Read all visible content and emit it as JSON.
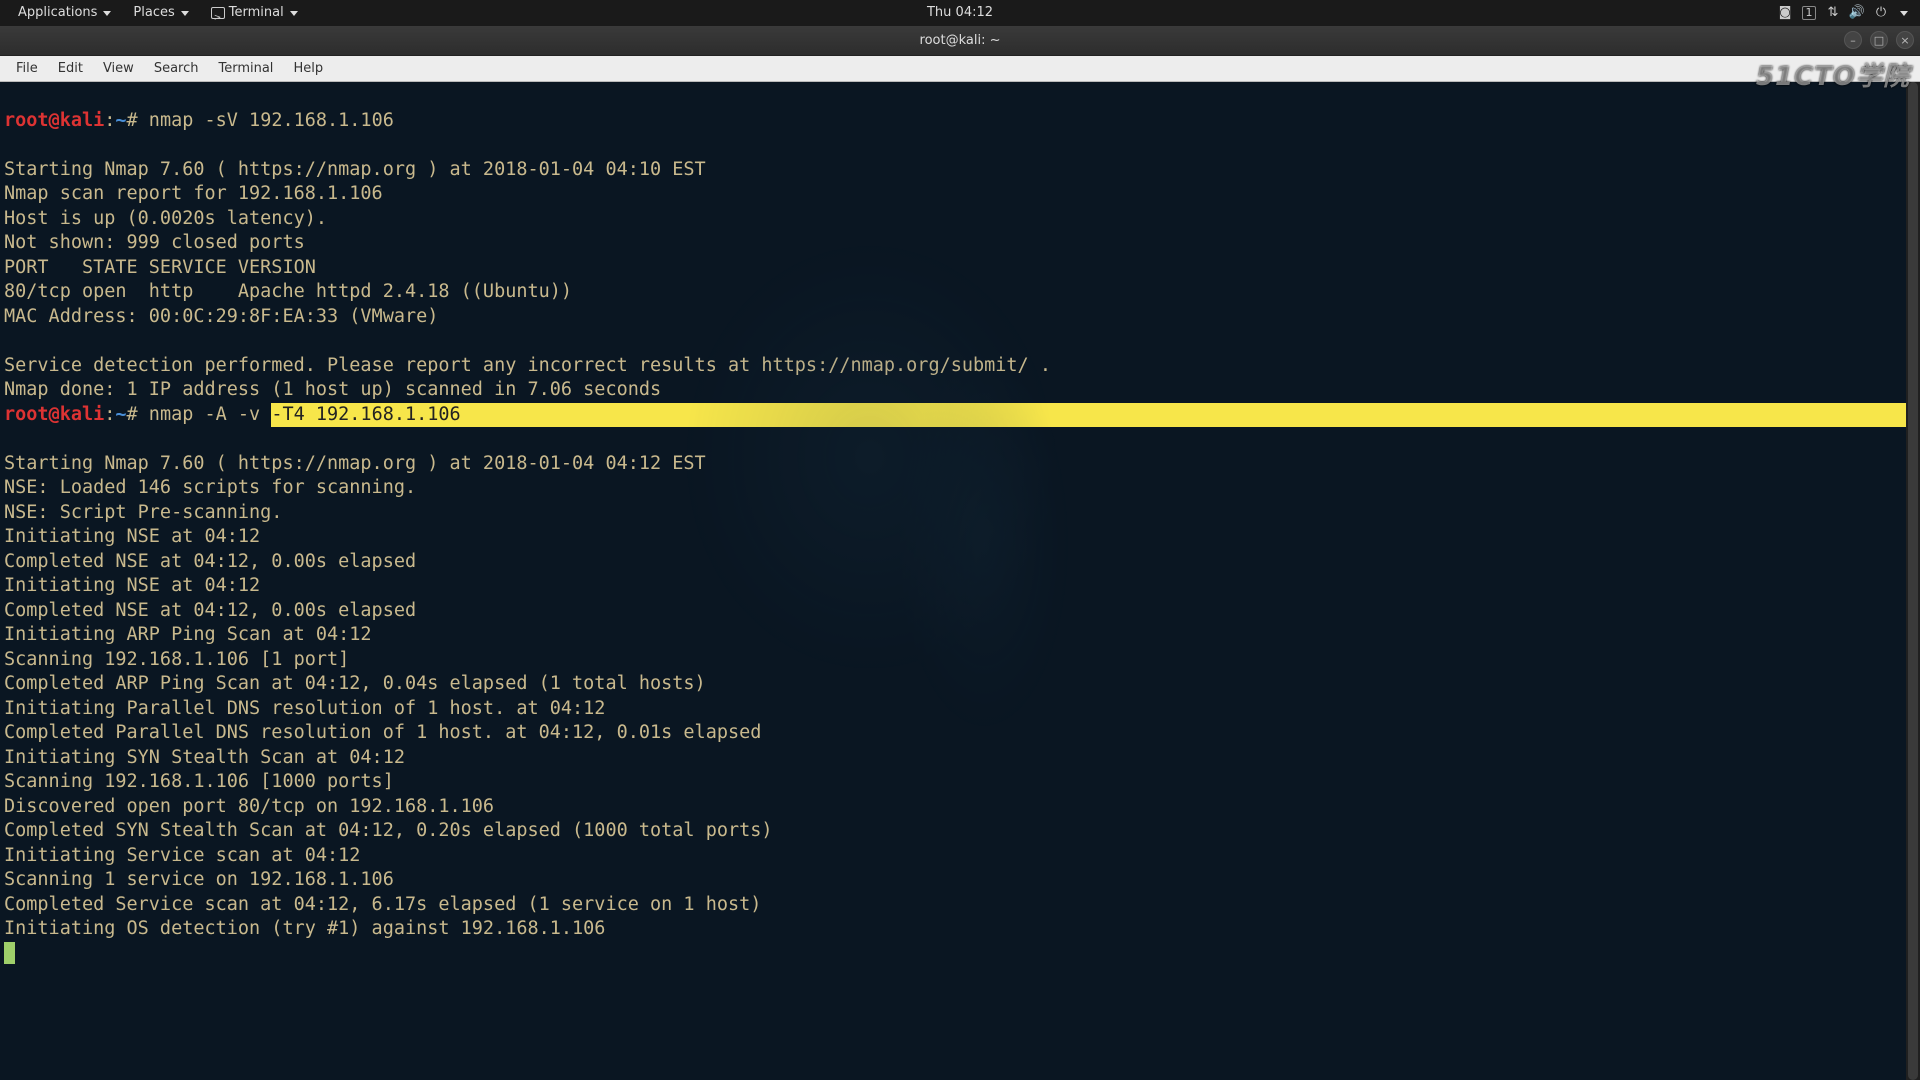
{
  "gnome": {
    "applications": "Applications",
    "places": "Places",
    "terminal": "Terminal",
    "clock": "Thu 04:12",
    "workspace": "1"
  },
  "window": {
    "title": "root@kali: ~"
  },
  "watermark": "51CTO学院",
  "menu": {
    "file": "File",
    "edit": "Edit",
    "view": "View",
    "search": "Search",
    "terminal": "Terminal",
    "help": "Help"
  },
  "prompt1": {
    "user": "root@kali",
    "sep1": ":",
    "path": "~",
    "hash": "#",
    "cmd": " nmap -sV 192.168.1.106"
  },
  "out1": {
    "l1": "Starting Nmap 7.60 ( https://nmap.org ) at 2018-01-04 04:10 EST",
    "l2": "Nmap scan report for 192.168.1.106",
    "l3": "Host is up (0.0020s latency).",
    "l4": "Not shown: 999 closed ports",
    "l5": "PORT   STATE SERVICE VERSION",
    "l6": "80/tcp open  http    Apache httpd 2.4.18 ((Ubuntu))",
    "l7": "MAC Address: 00:0C:29:8F:EA:33 (VMware)",
    "l8": "Service detection performed. Please report any incorrect results at https://nmap.org/submit/ .",
    "l9": "Nmap done: 1 IP address (1 host up) scanned in 7.06 seconds"
  },
  "prompt2": {
    "user": "root@kali",
    "sep1": ":",
    "path": "~",
    "hash": "#",
    "cmd_pre": " nmap -A -v ",
    "cmd_sel": "-T4 192.168.1.106"
  },
  "out2": {
    "l1": "Starting Nmap 7.60 ( https://nmap.org ) at 2018-01-04 04:12 EST",
    "l2": "NSE: Loaded 146 scripts for scanning.",
    "l3": "NSE: Script Pre-scanning.",
    "l4": "Initiating NSE at 04:12",
    "l5": "Completed NSE at 04:12, 0.00s elapsed",
    "l6": "Initiating NSE at 04:12",
    "l7": "Completed NSE at 04:12, 0.00s elapsed",
    "l8": "Initiating ARP Ping Scan at 04:12",
    "l9": "Scanning 192.168.1.106 [1 port]",
    "l10": "Completed ARP Ping Scan at 04:12, 0.04s elapsed (1 total hosts)",
    "l11": "Initiating Parallel DNS resolution of 1 host. at 04:12",
    "l12": "Completed Parallel DNS resolution of 1 host. at 04:12, 0.01s elapsed",
    "l13": "Initiating SYN Stealth Scan at 04:12",
    "l14": "Scanning 192.168.1.106 [1000 ports]",
    "l15": "Discovered open port 80/tcp on 192.168.1.106",
    "l16": "Completed SYN Stealth Scan at 04:12, 0.20s elapsed (1000 total ports)",
    "l17": "Initiating Service scan at 04:12",
    "l18": "Scanning 1 service on 192.168.1.106",
    "l19": "Completed Service scan at 04:12, 6.17s elapsed (1 service on 1 host)",
    "l20": "Initiating OS detection (try #1) against 192.168.1.106"
  }
}
